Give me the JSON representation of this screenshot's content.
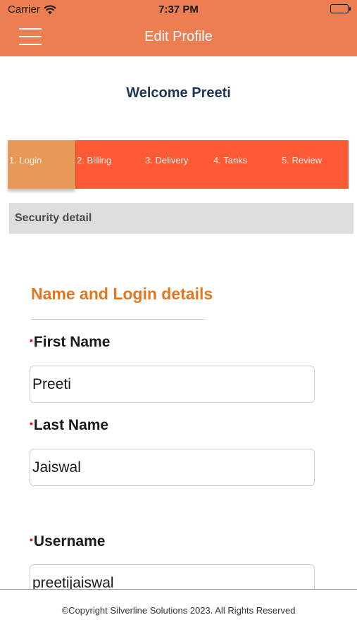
{
  "status_bar": {
    "carrier": "Carrier",
    "time": "7:37 PM",
    "wifi_icon": "wifi-icon",
    "battery_icon": "battery-icon"
  },
  "header": {
    "title": "Edit Profile",
    "menu_icon": "hamburger-menu-icon",
    "color": "#EC7E52"
  },
  "welcome": "Welcome Preeti",
  "steps": [
    {
      "label": "1. Login",
      "active": true
    },
    {
      "label": "2. Billing",
      "active": false
    },
    {
      "label": "3. Delivery",
      "active": false
    },
    {
      "label": "4. Tanks",
      "active": false
    },
    {
      "label": "5. Review",
      "active": false
    }
  ],
  "section": {
    "title": "Security detail"
  },
  "form": {
    "heading": "Name and Login details",
    "fields": [
      {
        "label": "First Name",
        "value": "Preeti",
        "required": true
      },
      {
        "label": "Last Name",
        "value": "Jaiswal",
        "required": true
      },
      {
        "label": "Username",
        "value": "preetijaiswal",
        "required": true
      }
    ]
  },
  "footer": {
    "text": "©Copyright Silverline Solutions 2023. All Rights Reserved"
  },
  "colors": {
    "step_bar": "#FE5A35",
    "step_active": "#E6A05A",
    "heading": "#E4761F",
    "welcome": "#1d3557"
  }
}
